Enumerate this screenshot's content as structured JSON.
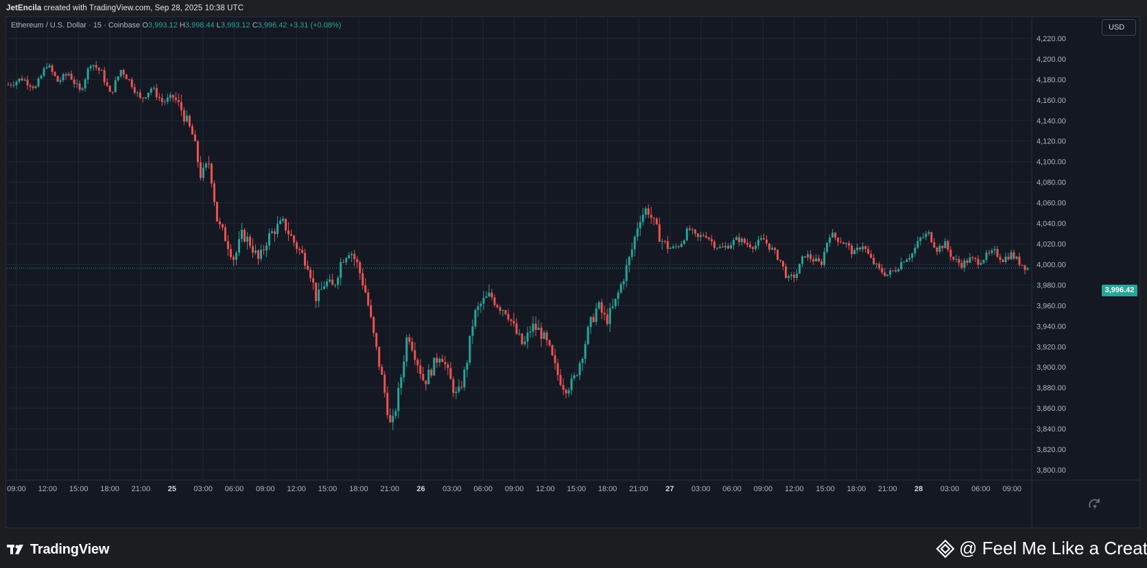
{
  "header": {
    "author": "JetEncila",
    "caption_rest": "created with TradingView.com, Sep 28, 2025 10:38 UTC"
  },
  "legend": {
    "symbol": "Ethereum / U.S. Dollar · 15 · Coinbase",
    "o_label": "O",
    "o_value": "3,993.12",
    "h_label": "H",
    "h_value": "3,998.44",
    "l_label": "L",
    "l_value": "3,993.12",
    "c_label": "C",
    "c_value": "3,996.42",
    "change": "+3.31 (+0.08%)"
  },
  "currency_button": "USD",
  "last_price_label": "3,996.42",
  "footer": {
    "brand": "TradingView",
    "watermark": "@ Feel Me Like a Creat..."
  },
  "colors": {
    "background": "#141823",
    "grid": "#232734",
    "up": "#26a69a",
    "down": "#ef5350",
    "text": "#b2b5be"
  },
  "icons": [
    "tradingview-logo-icon",
    "binance-diamond-icon",
    "auto-scale-reset-icon"
  ],
  "chart_data": {
    "type": "candlestick",
    "interval": "15",
    "ylim": [
      3790,
      4240
    ],
    "y_ticks": [
      3800,
      3820,
      3840,
      3860,
      3880,
      3900,
      3920,
      3940,
      3960,
      3980,
      4000,
      4020,
      4040,
      4060,
      4080,
      4100,
      4120,
      4140,
      4160,
      4180,
      4200,
      4220
    ],
    "y_tick_labels": [
      "3,800.00",
      "3,820.00",
      "3,840.00",
      "3,860.00",
      "3,880.00",
      "3,900.00",
      "3,920.00",
      "3,940.00",
      "3,960.00",
      "3,980.00",
      "4,000.00",
      "4,020.00",
      "4,040.00",
      "4,060.00",
      "4,080.00",
      "4,100.00",
      "4,120.00",
      "4,140.00",
      "4,160.00",
      "4,180.00",
      "4,200.00",
      "4,220.00"
    ],
    "x_ticks": [
      "09:00",
      "12:00",
      "15:00",
      "18:00",
      "21:00",
      "25",
      "03:00",
      "06:00",
      "09:00",
      "12:00",
      "15:00",
      "18:00",
      "21:00",
      "26",
      "03:00",
      "06:00",
      "09:00",
      "12:00",
      "15:00",
      "18:00",
      "21:00",
      "27",
      "03:00",
      "06:00",
      "09:00",
      "12:00",
      "15:00",
      "18:00",
      "21:00",
      "28",
      "03:00",
      "06:00",
      "09:00"
    ],
    "x_ticks_bold": [
      "25",
      "26",
      "27",
      "28"
    ],
    "last_price": 3996.42,
    "close_path": [
      {
        "t": 0,
        "p": 4175
      },
      {
        "t": 5,
        "p": 4181
      },
      {
        "t": 10,
        "p": 4172
      },
      {
        "t": 14,
        "p": 4195
      },
      {
        "t": 18,
        "p": 4178
      },
      {
        "t": 22,
        "p": 4186
      },
      {
        "t": 26,
        "p": 4168
      },
      {
        "t": 30,
        "p": 4197
      },
      {
        "t": 34,
        "p": 4186
      },
      {
        "t": 37,
        "p": 4165
      },
      {
        "t": 41,
        "p": 4190
      },
      {
        "t": 45,
        "p": 4175
      },
      {
        "t": 48,
        "p": 4160
      },
      {
        "t": 52,
        "p": 4172
      },
      {
        "t": 56,
        "p": 4158
      },
      {
        "t": 60,
        "p": 4163
      },
      {
        "t": 63,
        "p": 4150
      },
      {
        "t": 67,
        "p": 4125
      },
      {
        "t": 70,
        "p": 4085
      },
      {
        "t": 73,
        "p": 4100
      },
      {
        "t": 76,
        "p": 4040
      },
      {
        "t": 79,
        "p": 4025
      },
      {
        "t": 82,
        "p": 4005
      },
      {
        "t": 85,
        "p": 4030
      },
      {
        "t": 88,
        "p": 4020
      },
      {
        "t": 91,
        "p": 4003
      },
      {
        "t": 94,
        "p": 4025
      },
      {
        "t": 97,
        "p": 4035
      },
      {
        "t": 100,
        "p": 4040
      },
      {
        "t": 103,
        "p": 4025
      },
      {
        "t": 106,
        "p": 4012
      },
      {
        "t": 109,
        "p": 4000
      },
      {
        "t": 112,
        "p": 3965
      },
      {
        "t": 115,
        "p": 3983
      },
      {
        "t": 118,
        "p": 3977
      },
      {
        "t": 121,
        "p": 4005
      },
      {
        "t": 124,
        "p": 4015
      },
      {
        "t": 127,
        "p": 3998
      },
      {
        "t": 130,
        "p": 3970
      },
      {
        "t": 133,
        "p": 3925
      },
      {
        "t": 136,
        "p": 3885
      },
      {
        "t": 139,
        "p": 3838
      },
      {
        "t": 142,
        "p": 3880
      },
      {
        "t": 145,
        "p": 3935
      },
      {
        "t": 148,
        "p": 3910
      },
      {
        "t": 151,
        "p": 3885
      },
      {
        "t": 154,
        "p": 3900
      },
      {
        "t": 157,
        "p": 3915
      },
      {
        "t": 160,
        "p": 3890
      },
      {
        "t": 163,
        "p": 3870
      },
      {
        "t": 166,
        "p": 3898
      },
      {
        "t": 169,
        "p": 3950
      },
      {
        "t": 172,
        "p": 3963
      },
      {
        "t": 175,
        "p": 3970
      },
      {
        "t": 178,
        "p": 3960
      },
      {
        "t": 181,
        "p": 3955
      },
      {
        "t": 184,
        "p": 3935
      },
      {
        "t": 187,
        "p": 3920
      },
      {
        "t": 190,
        "p": 3940
      },
      {
        "t": 193,
        "p": 3935
      },
      {
        "t": 196,
        "p": 3920
      },
      {
        "t": 199,
        "p": 3895
      },
      {
        "t": 202,
        "p": 3880
      },
      {
        "t": 205,
        "p": 3885
      },
      {
        "t": 208,
        "p": 3910
      },
      {
        "t": 211,
        "p": 3940
      },
      {
        "t": 214,
        "p": 3960
      },
      {
        "t": 217,
        "p": 3945
      },
      {
        "t": 220,
        "p": 3960
      },
      {
        "t": 223,
        "p": 3985
      },
      {
        "t": 226,
        "p": 4010
      },
      {
        "t": 229,
        "p": 4045
      },
      {
        "t": 232,
        "p": 4055
      },
      {
        "t": 235,
        "p": 4035
      },
      {
        "t": 238,
        "p": 4020
      },
      {
        "t": 241,
        "p": 4015
      },
      {
        "t": 244,
        "p": 4020
      },
      {
        "t": 247,
        "p": 4035
      },
      {
        "t": 250,
        "p": 4025
      },
      {
        "t": 253,
        "p": 4030
      },
      {
        "t": 256,
        "p": 4020
      },
      {
        "t": 259,
        "p": 4015
      },
      {
        "t": 262,
        "p": 4020
      },
      {
        "t": 265,
        "p": 4025
      },
      {
        "t": 268,
        "p": 4020
      },
      {
        "t": 271,
        "p": 4018
      },
      {
        "t": 274,
        "p": 4025
      },
      {
        "t": 277,
        "p": 4015
      },
      {
        "t": 280,
        "p": 4005
      },
      {
        "t": 283,
        "p": 3985
      },
      {
        "t": 286,
        "p": 3990
      },
      {
        "t": 289,
        "p": 4010
      },
      {
        "t": 292,
        "p": 4005
      },
      {
        "t": 295,
        "p": 4000
      },
      {
        "t": 298,
        "p": 4030
      },
      {
        "t": 301,
        "p": 4025
      },
      {
        "t": 304,
        "p": 4020
      },
      {
        "t": 307,
        "p": 4010
      },
      {
        "t": 310,
        "p": 4020
      },
      {
        "t": 313,
        "p": 4005
      },
      {
        "t": 316,
        "p": 3995
      },
      {
        "t": 319,
        "p": 3990
      },
      {
        "t": 322,
        "p": 3995
      },
      {
        "t": 325,
        "p": 4005
      },
      {
        "t": 328,
        "p": 4010
      },
      {
        "t": 331,
        "p": 4025
      },
      {
        "t": 334,
        "p": 4030
      },
      {
        "t": 337,
        "p": 4015
      },
      {
        "t": 340,
        "p": 4020
      },
      {
        "t": 343,
        "p": 4005
      },
      {
        "t": 346,
        "p": 4000
      },
      {
        "t": 349,
        "p": 4005
      },
      {
        "t": 352,
        "p": 4003
      },
      {
        "t": 355,
        "p": 4008
      },
      {
        "t": 358,
        "p": 4012
      },
      {
        "t": 361,
        "p": 4005
      },
      {
        "t": 364,
        "p": 4010
      },
      {
        "t": 367,
        "p": 4002
      },
      {
        "t": 370,
        "p": 3996
      }
    ]
  }
}
